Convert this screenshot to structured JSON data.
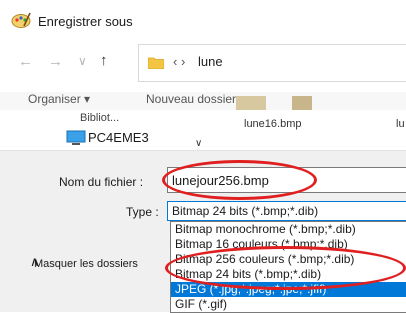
{
  "window": {
    "title": "Enregistrer sous"
  },
  "nav": {
    "back_icon": "←",
    "forward_icon": "→",
    "recent_icon": "∨",
    "up_icon": "↑",
    "path_separators": "‹  ›",
    "path": "lune"
  },
  "toolbar": {
    "organize_label": "Organiser ▾",
    "new_folder_label": "Nouveau dossier"
  },
  "navigation_pane": {
    "pc_partial": "Bibliot...",
    "pc_label": "PC4EME3",
    "chevron": "∨"
  },
  "files": [
    {
      "name": "lune16.bmp"
    },
    {
      "name": "lu"
    }
  ],
  "form": {
    "filename_label": "Nom du fichier :",
    "filename_value": "lunejour256.bmp",
    "type_label": "Type :",
    "type_value": "Bitmap 24 bits (*.bmp;*.dib)",
    "type_options": [
      "Bitmap monochrome (*.bmp;*.dib)",
      "Bitmap 16 couleurs (*.bmp;*.dib)",
      "Bitmap 256 couleurs (*.bmp;*.dib)",
      "Bitmap 24 bits (*.bmp;*.dib)",
      "JPEG (*.jpg;*.jpeg;*.jpe;*.jfif)",
      "GIF (*.gif)"
    ],
    "selected_option_index": 4,
    "hide_folders_label": "Masquer les dossiers",
    "hide_chevron": "∧"
  },
  "colors": {
    "accent": "#0078d7",
    "annotation": "#e02020"
  }
}
